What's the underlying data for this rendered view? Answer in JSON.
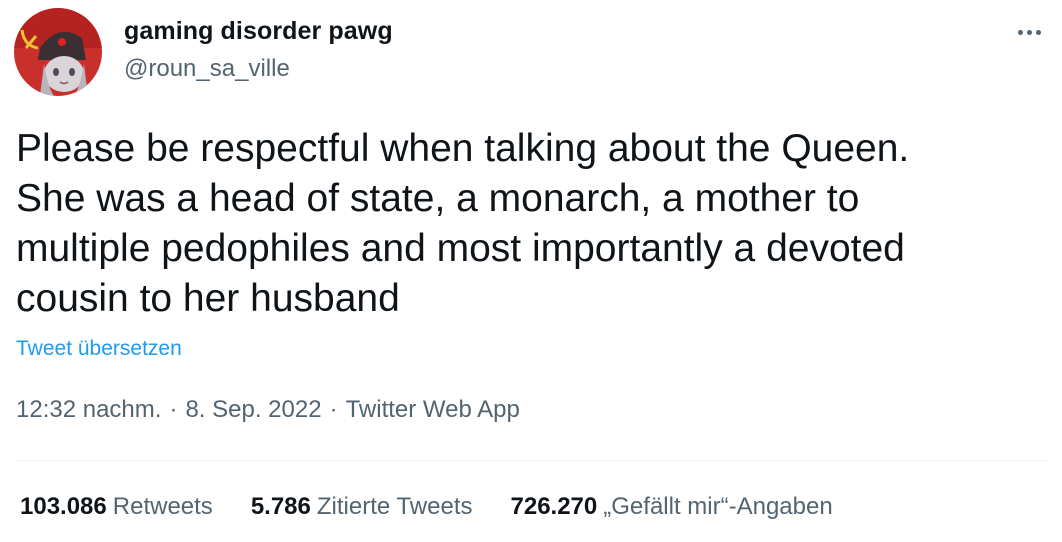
{
  "user": {
    "display_name": "gaming disorder pawg",
    "handle": "@roun_sa_ville"
  },
  "tweet": {
    "text": "Please be respectful when talking about the Queen.\nShe was a head of state, a monarch, a mother to\nmultiple pedophiles and most importantly a devoted\ncousin to her husband",
    "translate_label": "Tweet übersetzen"
  },
  "meta": {
    "time": "12:32 nachm.",
    "separator": "·",
    "date": "8. Sep. 2022",
    "source": "Twitter Web App"
  },
  "stats": {
    "retweets": {
      "count": "103.086",
      "label": "Retweets"
    },
    "quotes": {
      "count": "5.786",
      "label": "Zitierte Tweets"
    },
    "likes": {
      "count": "726.270",
      "label": "„Gefällt mir“-Angaben"
    }
  },
  "icons": {
    "more": "more-dots-icon",
    "avatar": "avatar"
  },
  "colors": {
    "text": "#0f1419",
    "secondary": "#536471",
    "link": "#1d9bf0",
    "divider": "#eff3f4"
  }
}
